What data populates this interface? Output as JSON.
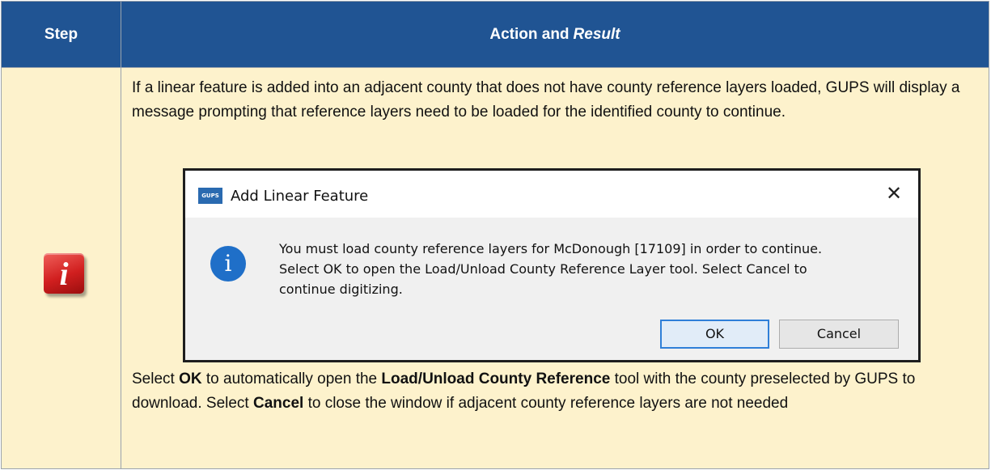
{
  "table": {
    "header": {
      "step_label": "Step",
      "action_label": "Action and",
      "result_label": "Result"
    },
    "row": {
      "step_icon": "info-icon",
      "step_icon_glyph": "i",
      "intro_text": "If a linear feature is added into an adjacent county that does not have county reference layers loaded, GUPS will display a message prompting that reference layers need to be loaded for the identified county to continue.",
      "dialog": {
        "app_logo_text": "GUPS",
        "title": "Add Linear Feature",
        "close_glyph": "✕",
        "info_glyph": "i",
        "message": "You must load county reference layers for McDonough [17109] in order to continue. Select OK to open the Load/Unload County Reference Layer tool. Select Cancel to continue digitizing.",
        "ok_label": "OK",
        "cancel_label": "Cancel"
      },
      "instruction": {
        "part1": "Select ",
        "ok_bold": "OK",
        "part2": " to automatically open the ",
        "tool_bold": "Load/Unload County Reference",
        "part3": " tool with the county preselected by GUPS to download. Select ",
        "cancel_bold": "Cancel",
        "part4": " to close the window if adjacent county reference layers are not needed"
      }
    }
  },
  "colors": {
    "header_bg": "#205493",
    "row_bg": "#fdf2cc",
    "icon_red": "#d11f1f",
    "dialog_info_blue": "#1f6fc8"
  }
}
